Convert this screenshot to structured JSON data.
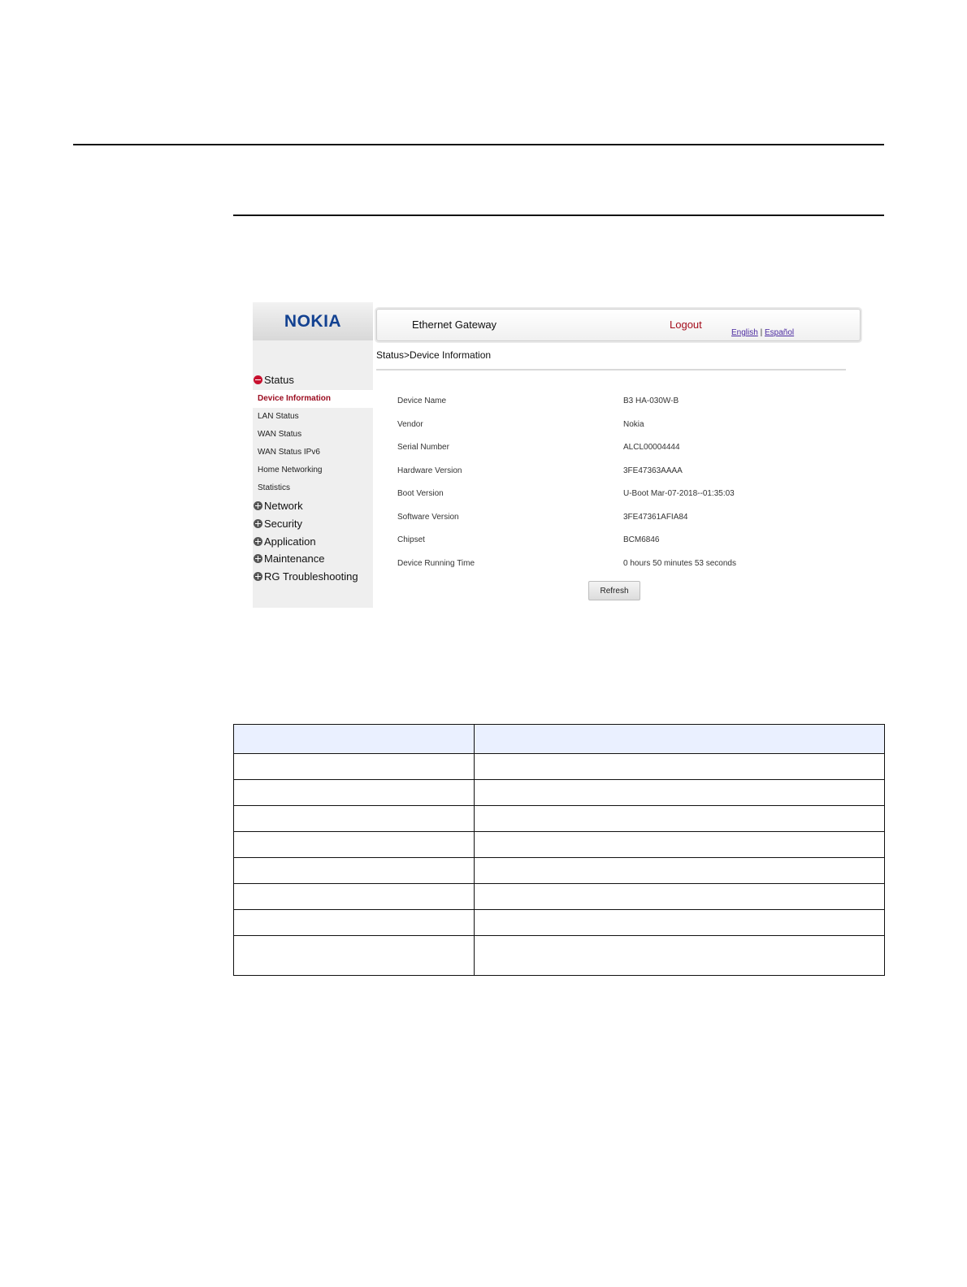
{
  "app": {
    "logo": "NOKIA",
    "title": "Ethernet Gateway",
    "logout": "Logout",
    "lang_english": "English",
    "lang_sep": "|",
    "lang_espanol": "Español"
  },
  "breadcrumb": "Status>Device Information",
  "sidebar": {
    "status": "Status",
    "sub_items": [
      "Device Information",
      "LAN Status",
      "WAN Status",
      "WAN Status IPv6",
      "Home Networking",
      "Statistics"
    ],
    "groups": [
      "Network",
      "Security",
      "Application",
      "Maintenance",
      "RG Troubleshooting"
    ]
  },
  "device_info": [
    {
      "label": "Device Name",
      "value": "B3 HA-030W-B"
    },
    {
      "label": "Vendor",
      "value": "Nokia"
    },
    {
      "label": "Serial Number",
      "value": "ALCL00004444"
    },
    {
      "label": "Hardware Version",
      "value": "3FE47363AAAA"
    },
    {
      "label": "Boot Version",
      "value": "U-Boot Mar-07-2018--01:35:03"
    },
    {
      "label": "Software Version",
      "value": "3FE47361AFIA84"
    },
    {
      "label": "Chipset",
      "value": "BCM6846"
    },
    {
      "label": "Device Running Time",
      "value": "0 hours 50 minutes 53 seconds"
    }
  ],
  "refresh_label": "Refresh",
  "colors": {
    "brand": "#124191",
    "active": "#9b0b1f",
    "logout": "#a40d1c",
    "table_header": "#eaf0ff"
  }
}
